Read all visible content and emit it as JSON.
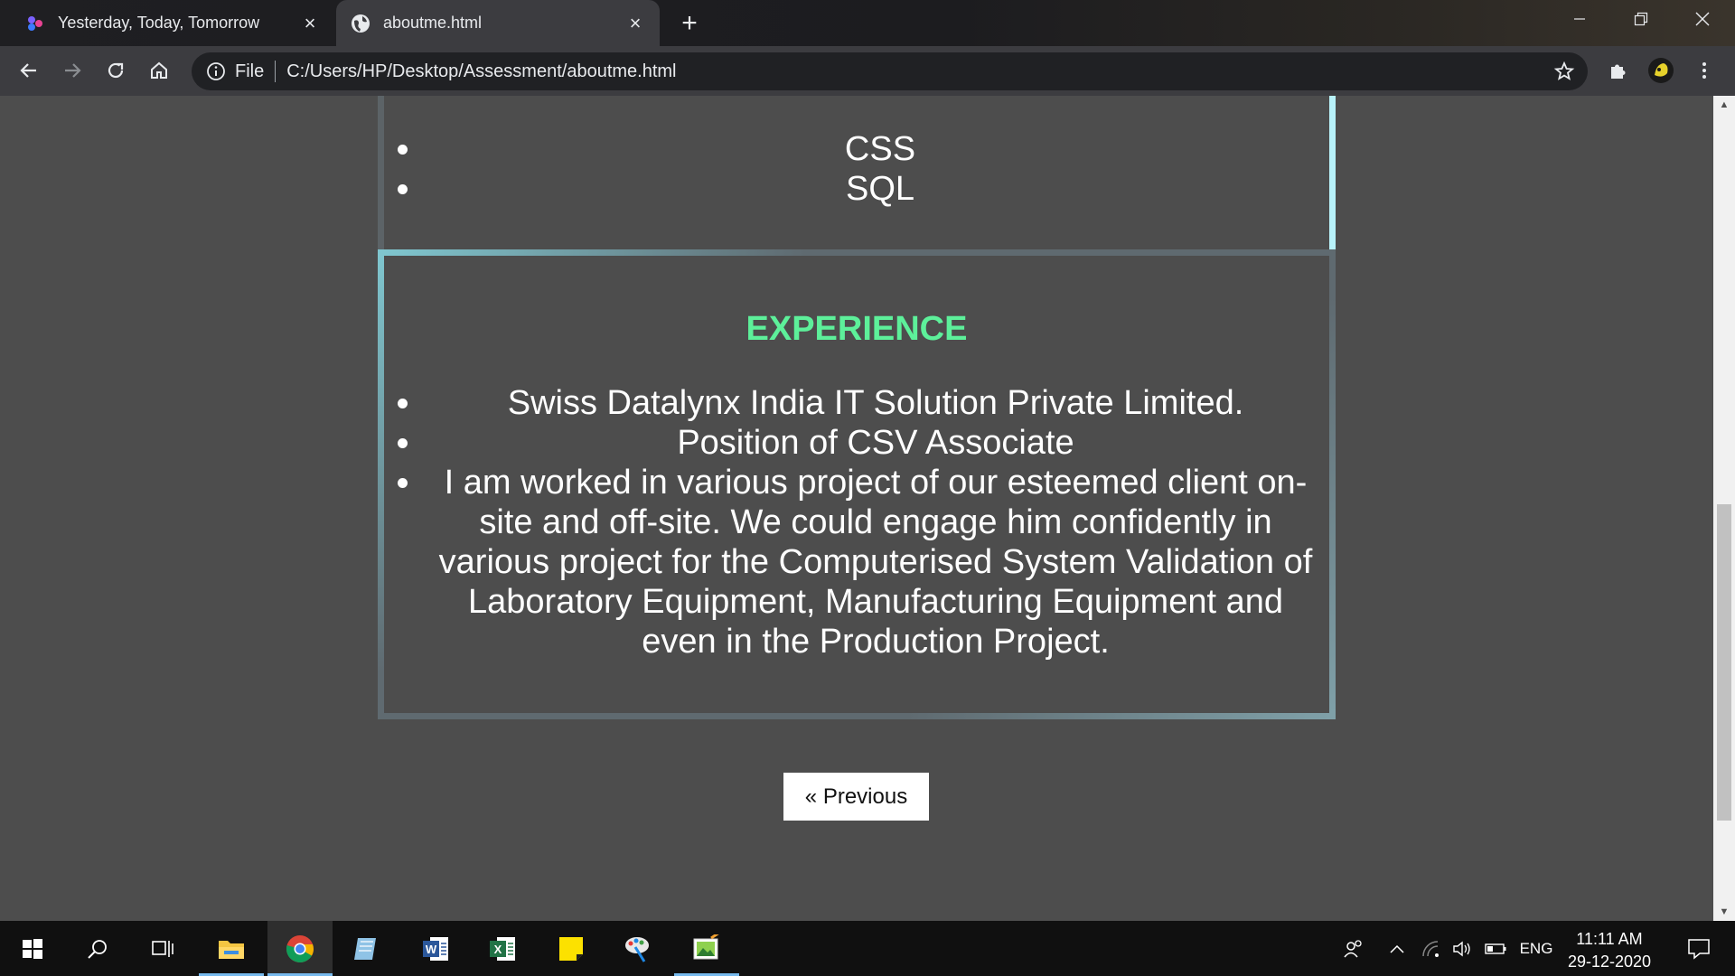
{
  "browser": {
    "tabs": [
      {
        "title": "Yesterday, Today, Tomorrow",
        "icon": "app-logo-icon",
        "active": false
      },
      {
        "title": "aboutme.html",
        "icon": "globe-icon",
        "active": true
      }
    ],
    "address": {
      "scheme_label": "File",
      "url": "C:/Users/HP/Desktop/Assessment/aboutme.html"
    }
  },
  "page": {
    "skills": {
      "items": [
        "CSS",
        "SQL"
      ]
    },
    "experience": {
      "heading": "EXPERIENCE",
      "heading_color": "#5df09a",
      "items": [
        "Swiss Datalynx India IT Solution Private Limited.",
        "Position of CSV Associate",
        "I am worked in various project of our esteemed client on-site and off-site. We could engage him confidently in various project for the Computerised System Validation of Laboratory Equipment, Manufacturing Equipment and even in the Production Project."
      ]
    },
    "prev_button": "« Previous",
    "background": "#4d4d4d"
  },
  "taskbar": {
    "apps": [
      "start-icon",
      "search-icon",
      "task-view-icon",
      "file-explorer-icon",
      "chrome-icon",
      "notepad-icon",
      "word-icon",
      "excel-icon",
      "sticky-notes-icon",
      "paint-icon",
      "image-editor-icon"
    ],
    "tray": {
      "language": "ENG",
      "time": "11:11 AM",
      "date": "29-12-2020"
    }
  }
}
